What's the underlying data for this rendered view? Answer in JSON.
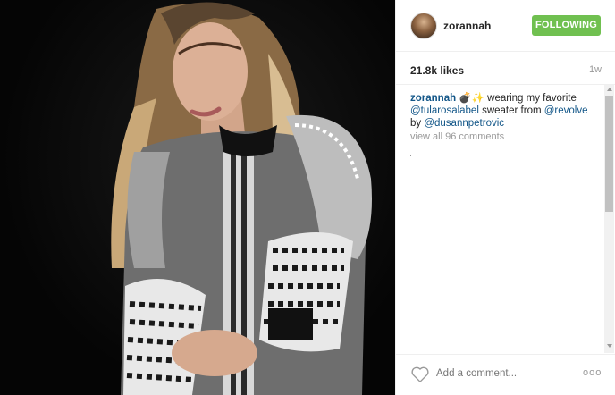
{
  "post": {
    "username": "zorannah",
    "follow_label": "FOLLOWING",
    "likes": "21.8k likes",
    "age": "1w"
  },
  "caption": {
    "username": "zorannah",
    "emoji": "💣✨",
    "text1": " wearing my favorite ",
    "mention1": "@tularosalabel",
    "text2": " sweater from ",
    "mention2": "@revolve",
    "text3": " ",
    "text4": "by ",
    "mention3": "@dusannpetrovic"
  },
  "comments": {
    "view_all": "view all 96 comments"
  },
  "footer": {
    "add_comment_placeholder": "Add a comment...",
    "more": "ooo"
  },
  "colors": {
    "follow": "#70c050",
    "link": "#125688",
    "muted": "#999999"
  },
  "icons": {
    "like": "heart-outline-icon",
    "more": "ellipsis-icon"
  }
}
